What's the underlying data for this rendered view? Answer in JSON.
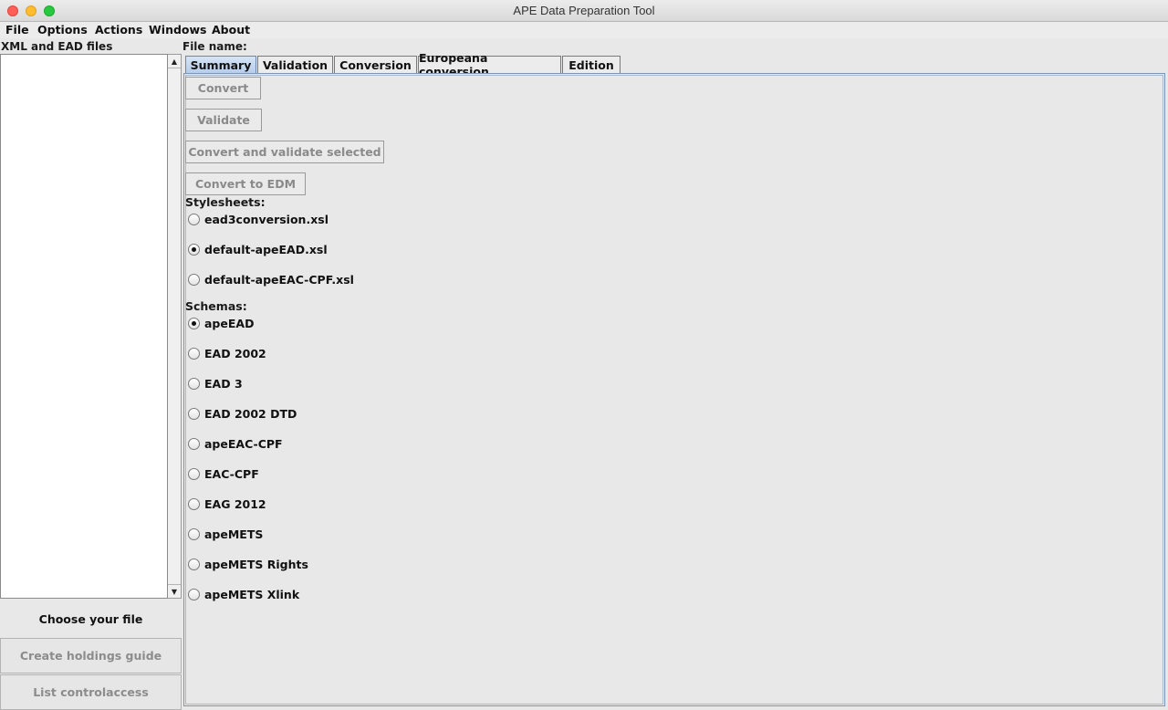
{
  "window": {
    "title": "APE Data Preparation Tool"
  },
  "menu": [
    "File",
    "Options",
    "Actions",
    "Windows",
    "About"
  ],
  "sidebar": {
    "title": "XML and EAD files",
    "buttons": {
      "choose": "Choose your file",
      "holdings": "Create holdings guide",
      "controlaccess": "List controlaccess"
    }
  },
  "main": {
    "file_name_label": "File name:",
    "tabs": [
      "Summary",
      "Validation",
      "Conversion",
      "Europeana conversion",
      "Edition"
    ],
    "active_tab": "Summary",
    "buttons": {
      "convert": "Convert",
      "validate": "Validate",
      "convert_validate": "Convert and validate selected",
      "convert_edm": "Convert to EDM"
    },
    "stylesheets": {
      "label": "Stylesheets:",
      "options": [
        {
          "label": "ead3conversion.xsl",
          "checked": false
        },
        {
          "label": "default-apeEAD.xsl",
          "checked": true
        },
        {
          "label": "default-apeEAC-CPF.xsl",
          "checked": false
        }
      ]
    },
    "schemas": {
      "label": "Schemas:",
      "options": [
        {
          "label": "apeEAD",
          "checked": true
        },
        {
          "label": "EAD 2002",
          "checked": false
        },
        {
          "label": "EAD 3",
          "checked": false
        },
        {
          "label": "EAD 2002 DTD",
          "checked": false
        },
        {
          "label": "apeEAC-CPF",
          "checked": false
        },
        {
          "label": "EAC-CPF",
          "checked": false
        },
        {
          "label": "EAG 2012",
          "checked": false
        },
        {
          "label": "apeMETS",
          "checked": false
        },
        {
          "label": "apeMETS Rights",
          "checked": false
        },
        {
          "label": "apeMETS Xlink",
          "checked": false
        }
      ]
    }
  }
}
